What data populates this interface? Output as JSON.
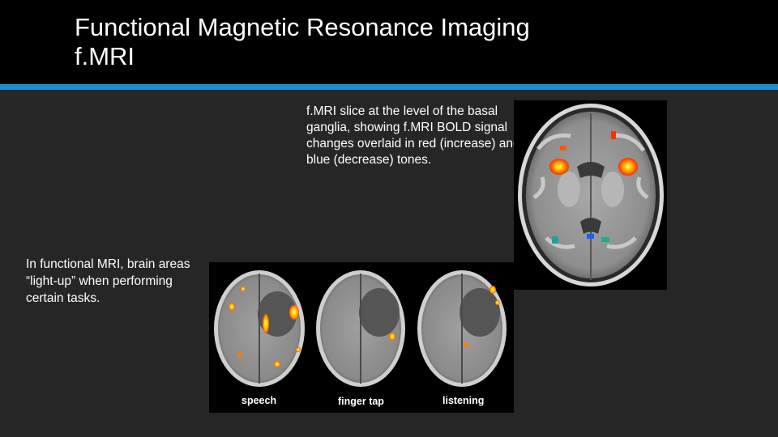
{
  "title": {
    "line1": "Functional Magnetic Resonance Imaging",
    "line2": "f.MRI"
  },
  "caption_top": "f.MRI slice at the level of the basal ganglia, showing f.MRI BOLD signal changes overlaid in red (increase) and blue (decrease) tones.",
  "caption_left": "In functional MRI, brain areas “light-up” when performing certain tasks.",
  "task_labels": [
    "speech",
    "finger tap",
    "listening"
  ],
  "colors": {
    "title_bar": "#000000",
    "accent": "#1a8fd0",
    "background": "#262626",
    "activation_increase": "#ff3a00",
    "activation_decrease": "#1a6cff"
  }
}
